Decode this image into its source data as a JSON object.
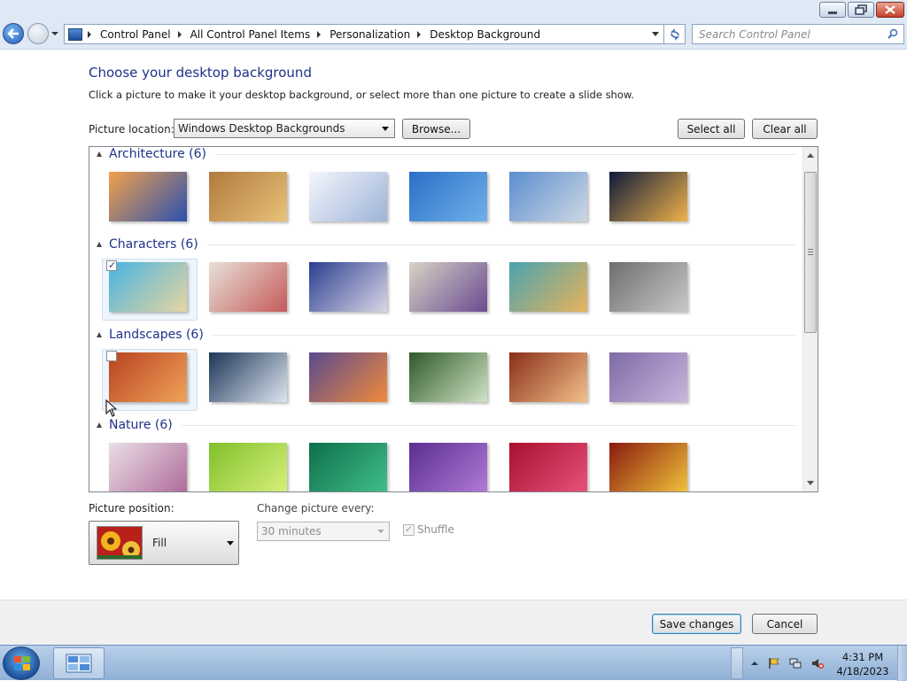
{
  "window": {
    "breadcrumb": [
      "Control Panel",
      "All Control Panel Items",
      "Personalization",
      "Desktop Background"
    ],
    "search_placeholder": "Search Control Panel"
  },
  "page": {
    "title": "Choose your desktop background",
    "subtitle": "Click a picture to make it your desktop background, or select more than one picture to create a slide show."
  },
  "picture_location": {
    "label": "Picture location:",
    "value": "Windows Desktop Backgrounds",
    "browse": "Browse...",
    "select_all": "Select all",
    "clear_all": "Clear all"
  },
  "groups": [
    {
      "label": "Architecture (6)",
      "thumbnails": [
        {
          "c1": "#f1a14a",
          "c2": "#2a4fb0",
          "selected": false,
          "checked": false
        },
        {
          "c1": "#b07a3c",
          "c2": "#e8c27a",
          "selected": false,
          "checked": false
        },
        {
          "c1": "#f4f6fb",
          "c2": "#9db3d8",
          "selected": false,
          "checked": false
        },
        {
          "c1": "#2a70c7",
          "c2": "#6fb0e8",
          "selected": false,
          "checked": false
        },
        {
          "c1": "#5b8ed0",
          "c2": "#cdd7e4",
          "selected": false,
          "checked": false
        },
        {
          "c1": "#0e1a3a",
          "c2": "#f0b24a",
          "selected": false,
          "checked": false
        }
      ]
    },
    {
      "label": "Characters (6)",
      "thumbnails": [
        {
          "c1": "#47b3e0",
          "c2": "#e7d6a2",
          "selected": true,
          "checked": true
        },
        {
          "c1": "#e7e1d8",
          "c2": "#c65a5a",
          "selected": false,
          "checked": false
        },
        {
          "c1": "#2b3f8f",
          "c2": "#d9d6e6",
          "selected": false,
          "checked": false
        },
        {
          "c1": "#d8d3c6",
          "c2": "#6a4b8f",
          "selected": false,
          "checked": false
        },
        {
          "c1": "#49a3b0",
          "c2": "#e8b35a",
          "selected": false,
          "checked": false
        },
        {
          "c1": "#6e6e6e",
          "c2": "#c8c8c8",
          "selected": false,
          "checked": false
        }
      ]
    },
    {
      "label": "Landscapes (6)",
      "thumbnails": [
        {
          "c1": "#b8421f",
          "c2": "#f0a35b",
          "selected": true,
          "checked": false
        },
        {
          "c1": "#1d3557",
          "c2": "#dde6f0",
          "selected": false,
          "checked": false
        },
        {
          "c1": "#5a4a8f",
          "c2": "#f08a3a",
          "selected": false,
          "checked": false
        },
        {
          "c1": "#2f5a2a",
          "c2": "#cfe3c5",
          "selected": false,
          "checked": false
        },
        {
          "c1": "#8a2e1a",
          "c2": "#f3c08a",
          "selected": false,
          "checked": false
        },
        {
          "c1": "#7f6aa6",
          "c2": "#c9b6dc",
          "selected": false,
          "checked": false
        }
      ]
    },
    {
      "label": "Nature (6)",
      "thumbnails": [
        {
          "c1": "#e9dfe6",
          "c2": "#b06b9a",
          "selected": false,
          "checked": false
        },
        {
          "c1": "#7fbf2a",
          "c2": "#d6f07a",
          "selected": false,
          "checked": false
        },
        {
          "c1": "#0f6e4a",
          "c2": "#3fbf8a",
          "selected": false,
          "checked": false
        },
        {
          "c1": "#5a2e8f",
          "c2": "#b07ad8",
          "selected": false,
          "checked": false
        },
        {
          "c1": "#a8102f",
          "c2": "#e8527a",
          "selected": false,
          "checked": false
        },
        {
          "c1": "#8a1a0f",
          "c2": "#f0c23a",
          "selected": false,
          "checked": false
        }
      ]
    }
  ],
  "picture_position": {
    "label": "Picture position:",
    "value": "Fill"
  },
  "change_picture": {
    "label": "Change picture every:",
    "value": "30 minutes",
    "shuffle_label": "Shuffle",
    "shuffle_checked": true
  },
  "actions": {
    "save": "Save changes",
    "cancel": "Cancel"
  },
  "taskbar": {
    "time": "4:31 PM",
    "date": "4/18/2023"
  },
  "colors": {
    "accent": "#1e3287",
    "selection": "#eef5fc"
  }
}
